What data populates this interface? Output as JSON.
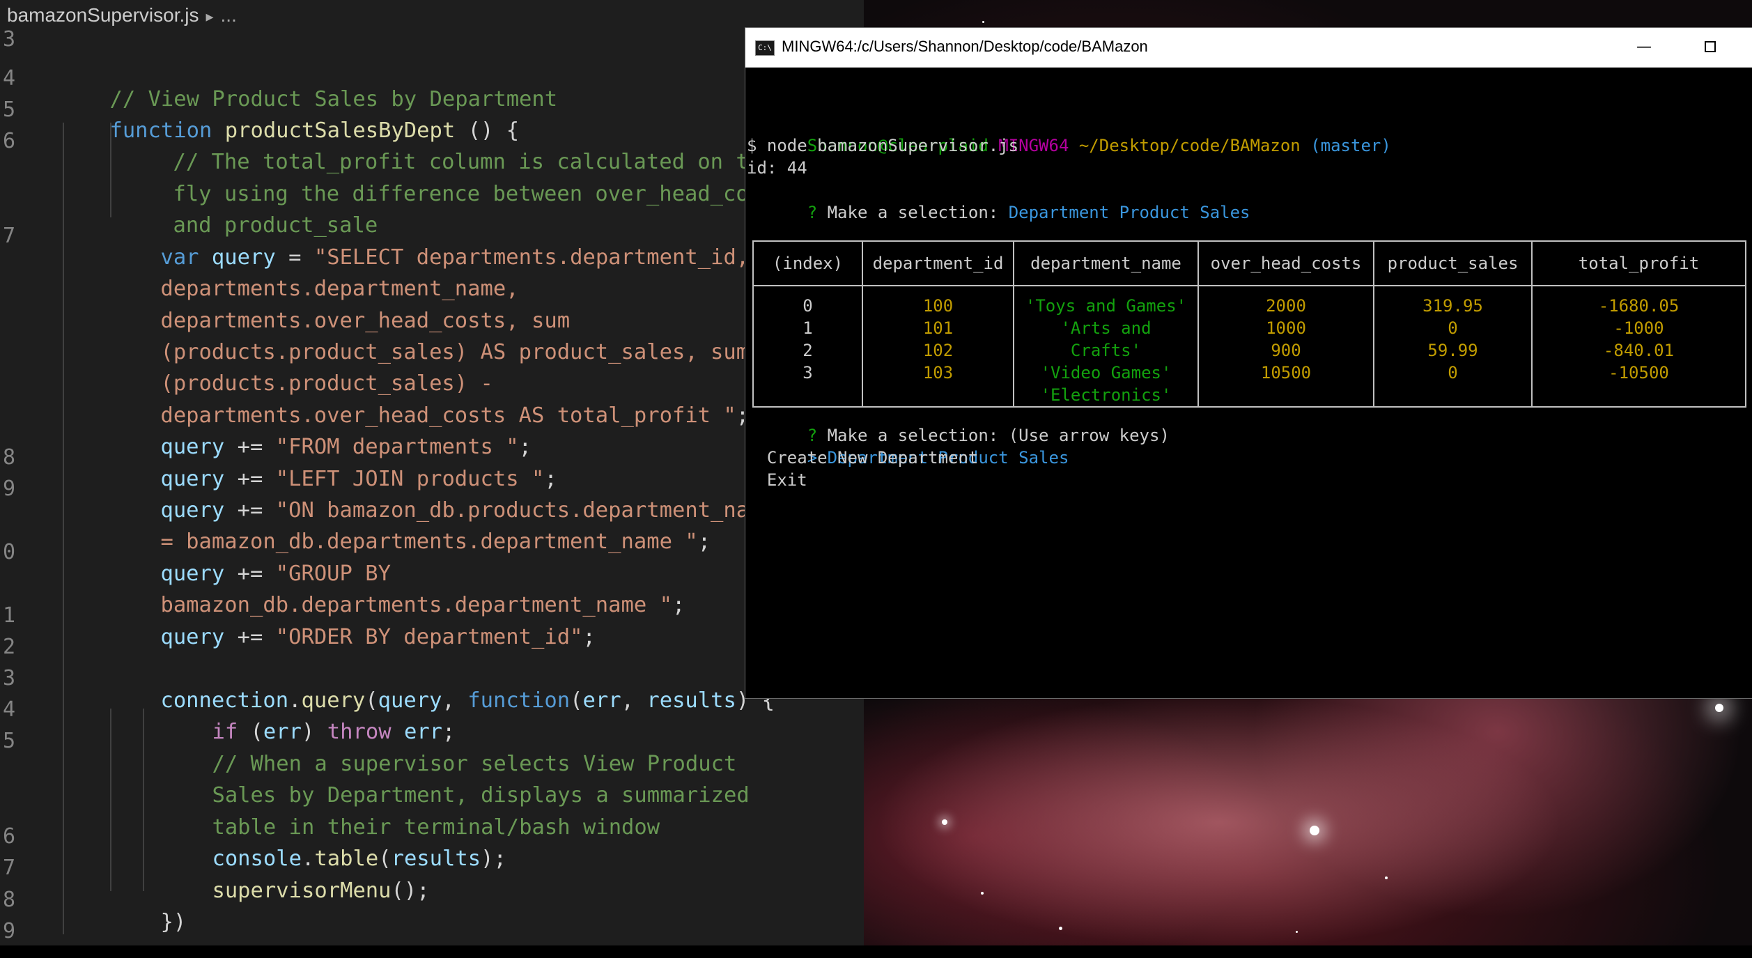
{
  "editor": {
    "filename": "bamazonSupervisor.js",
    "crumb_chevron": "▸",
    "crumb_more": "...",
    "line_numbers": [
      "3",
      "4",
      "5",
      "6",
      "7",
      "8",
      "9",
      "0",
      "1",
      "2",
      "3",
      "4",
      "5",
      "6",
      "7",
      "8",
      "9"
    ]
  },
  "code": {
    "l4_comment": "// View Product Sales by Department",
    "l5_function_kw": "function",
    "l5_name": "productSalesByDept",
    "l5_rest": " () {",
    "l6_comment_a": "// The total_profit column is calculated on the",
    "l6_comment_b": "fly using the difference between over_head_costs",
    "l6_comment_c": "and product_sale",
    "l7_var_kw": "var",
    "l7_var": "query",
    "l7_eq": " = ",
    "l7_str_a": "\"SELECT departments.department_id,",
    "l7_str_b": "departments.department_name,",
    "l7_str_c": "departments.over_head_costs, sum",
    "l7_str_d": "(products.product_sales) AS product_sales, sum",
    "l7_str_e": "(products.product_sales) -",
    "l7_str_f": "departments.over_head_costs AS total_profit \"",
    "l7_semi": ";",
    "query_var": "query",
    "plus_eq": " += ",
    "l8_str": "\"FROM departments \"",
    "l9_str": "\"LEFT JOIN products \"",
    "l10_str_a": "\"ON bamazon_db.products.department_name",
    "l10_str_b": "= bamazon_db.departments.department_name \"",
    "l11_str_a": "\"GROUP BY",
    "l11_str_b": "bamazon_db.departments.department_name \"",
    "l12_str": "\"ORDER BY department_id\"",
    "semi": ";",
    "l14_conn": "connection",
    "l14_dot": ".",
    "l14_query": "query",
    "l14_open": "(",
    "l14_arg": "query",
    "l14_comma": ", ",
    "l14_fnkw": "function",
    "l14_p1": "err",
    "l14_p2": "results",
    "l14_close": ") {",
    "l15_if": "if",
    "l15_open": " (",
    "l15_err": "err",
    "l15_close": ") ",
    "l15_throw": "throw",
    "l15_err2": "err",
    "l16_comment_a": "// When a supervisor selects View Product",
    "l16_comment_b": "Sales by Department, displays a summarized",
    "l16_comment_c": "table in their terminal/bash window",
    "l17_console": "console",
    "l17_table": "table",
    "l17_arg": "results",
    "l17_end": ");",
    "l18_call": "supervisorMenu",
    "l18_end": "();",
    "l19_close": "})"
  },
  "terminal": {
    "title": "MINGW64:/c/Users/Shannon/Desktop/code/BAMazon",
    "icon_text": "C:\\",
    "btn_minimize": "—",
    "prompt_user": "Shannon@clearplaid",
    "prompt_env": "MINGW64",
    "prompt_path": "~/Desktop/code/BAMazon",
    "prompt_branch": "(master)",
    "command": "$ node bamazonSupervisor.js",
    "id_line": "id: 44",
    "q_mark": "?",
    "q1_label": "Make a selection:",
    "q1_answer": "Department Product Sales",
    "table": {
      "headers": [
        "(index)",
        "department_id",
        "department_name",
        "over_head_costs",
        "product_sales",
        "total_profit"
      ],
      "index": [
        "0",
        "1",
        "2",
        "3"
      ],
      "department_id": [
        "100",
        "101",
        "102",
        "103"
      ],
      "department_name": [
        "'Toys and Games'",
        "'Arts and Crafts'",
        "'Video Games'",
        "'Electronics'"
      ],
      "over_head_costs": [
        "2000",
        "1000",
        "900",
        "10500"
      ],
      "product_sales": [
        "319.95",
        "0",
        "59.99",
        "0"
      ],
      "total_profit": [
        "-1680.05",
        "-1000",
        "-840.01",
        "-10500"
      ]
    },
    "q2_label": "Make a selection:",
    "q2_hint": "(Use arrow keys)",
    "menu_cursor": ">",
    "menu": [
      "Department Product Sales",
      "Create New Department",
      "Exit"
    ]
  },
  "colors": {
    "editor_bg": "#1e1e1e",
    "keyword": "#569cd6",
    "string": "#ce9178",
    "comment": "#6a9955",
    "terminal_green": "#13a10e",
    "terminal_magenta": "#b4009e",
    "terminal_yellow": "#c19c00",
    "terminal_cyan": "#3a96dd"
  }
}
